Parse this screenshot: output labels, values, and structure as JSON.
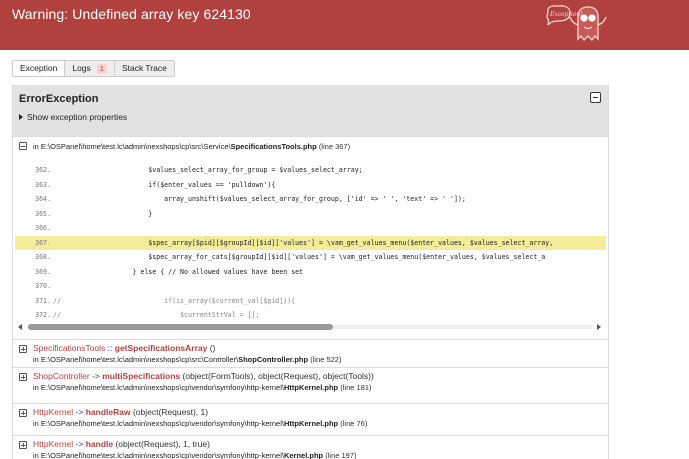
{
  "header": {
    "title": "Warning: Undefined array key 624130",
    "logo_text": "Exception!"
  },
  "tabs": [
    {
      "label": "Exception",
      "active": true
    },
    {
      "label": "Logs",
      "badge": "1"
    },
    {
      "label": "Stack Trace"
    }
  ],
  "exception": {
    "class": "ErrorException",
    "properties_label": "Show exception properties"
  },
  "frames": [
    {
      "expanded": true,
      "prefix": "in ",
      "path": "E:\\OSPanel\\home\\test.lc\\admin\\nexshops\\cp\\src\\Service\\",
      "file": "SpecificationsTools.php",
      "line": "(line 367)",
      "code": [
        {
          "n": "362.",
          "indent": "                        ",
          "text": "$values_select_array_for_group = $values_select_array;"
        },
        {
          "n": "363.",
          "indent": "                        ",
          "text": "if($enter_values == 'pulldown'){"
        },
        {
          "n": "364.",
          "indent": "                            ",
          "text": "array_unshift($values_select_array_for_group, ['id' => ' ', 'text' => ' ']);"
        },
        {
          "n": "365.",
          "indent": "                        ",
          "text": "}"
        },
        {
          "n": "366.",
          "indent": "",
          "text": ""
        },
        {
          "n": "367.",
          "indent": "                        ",
          "text": "$spec_array[$pid][$groupId][$id]['values'] = \\vam_get_values_menu($enter_values, $values_select_array, ",
          "highlight": true
        },
        {
          "n": "368.",
          "indent": "                        ",
          "text": "$spec_array_for_cats[$groupId][$id]['values'] = \\vam_get_values_menu($enter_values, $values_select_a"
        },
        {
          "n": "369.",
          "indent": "                    ",
          "text": "} else { // No allowed values have been set"
        },
        {
          "n": "370.",
          "indent": "",
          "text": ""
        },
        {
          "n": "371.",
          "indent": "",
          "text": "//                          if(is_array($current_val[$pid])){"
        },
        {
          "n": "372.",
          "indent": "",
          "text": "//                              $currentStrVal = [];"
        }
      ]
    },
    {
      "class": "SpecificationsTools",
      "sep": " :: ",
      "method": "getSpecificationsArray",
      "args": " ()",
      "path": "E:\\OSPanel\\home\\test.lc\\admin\\nexshops\\cp\\src\\Controller\\",
      "file": "ShopController.php",
      "line": "(line 522)"
    },
    {
      "class": "ShopController",
      "sep": " -> ",
      "method": "multiSpecifications",
      "args": " (object(FormTools), object(Request), object(Tools))",
      "path": "E:\\OSPanel\\home\\test.lc\\admin\\nexshops\\cp\\vendor\\symfony\\http-kernel\\",
      "file": "HttpKernel.php",
      "line": "(line 181)"
    },
    {
      "class": "HttpKernel",
      "sep": " -> ",
      "method": "handleRaw",
      "args": " (object(Request), 1)",
      "path": "E:\\OSPanel\\home\\test.lc\\admin\\nexshops\\cp\\vendor\\symfony\\http-kernel\\",
      "file": "HttpKernel.php",
      "line": "(line 76)"
    },
    {
      "class": "HttpKernel",
      "sep": " -> ",
      "method": "handle",
      "args": " (object(Request), 1, true)",
      "path": "E:\\OSPanel\\home\\test.lc\\admin\\nexshops\\cp\\vendor\\symfony\\http-kernel\\",
      "file": "Kernel.php",
      "line": "(line 197)"
    }
  ],
  "colors": {
    "header_bg": "#b0413e",
    "highlight_line": "#f3ed9a"
  }
}
